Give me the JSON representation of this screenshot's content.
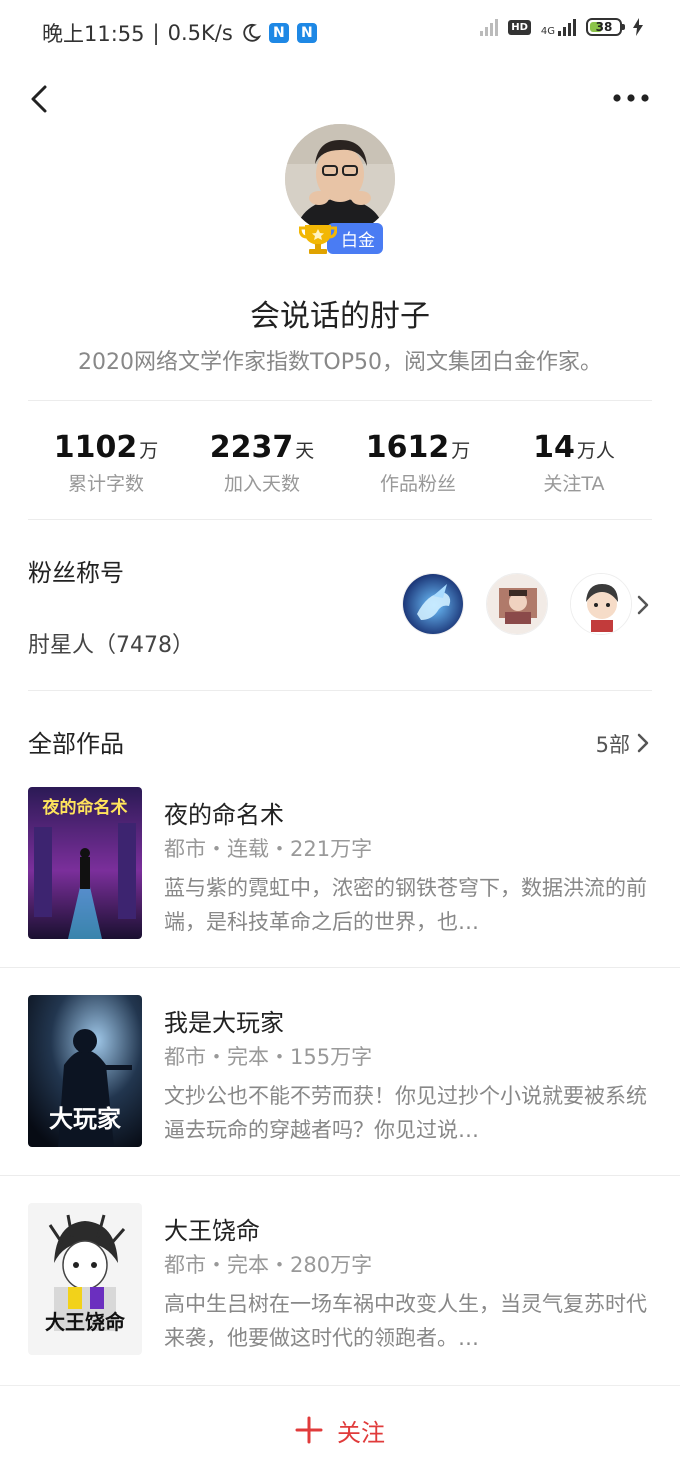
{
  "status_bar": {
    "time": "晚上11:55",
    "separator": "|",
    "speed": "0.5K/s",
    "hd": "HD",
    "network": "4G",
    "battery": "38"
  },
  "header": {
    "back_icon": "chevron-left-icon",
    "more_icon": "more-horizontal-icon"
  },
  "author": {
    "badge": "白金",
    "name": "会说话的肘子",
    "description": "2020网络文学作家指数TOP50，阅文集团白金作家。"
  },
  "stats": [
    {
      "value": "1102",
      "unit": "万",
      "label": "累计字数"
    },
    {
      "value": "2237",
      "unit": "天",
      "label": "加入天数"
    },
    {
      "value": "1612",
      "unit": "万",
      "label": "作品粉丝"
    },
    {
      "value": "14",
      "unit": "万人",
      "label": "关注TA"
    }
  ],
  "fans": {
    "title": "粉丝称号",
    "value": "肘星人（7478）"
  },
  "works": {
    "title": "全部作品",
    "count": "5部",
    "books": [
      {
        "title": "夜的命名术",
        "meta": "都市・连载・221万字",
        "desc": "蓝与紫的霓虹中，浓密的钢铁苍穹下，数据洪流的前端，是科技革命之后的世界，也…",
        "cover_text": "夜的命名术"
      },
      {
        "title": "我是大玩家",
        "meta": "都市・完本・155万字",
        "desc": "文抄公也不能不劳而获！你见过抄个小说就要被系统逼去玩命的穿越者吗？你见过说…",
        "cover_text": "大玩家"
      },
      {
        "title": "大王饶命",
        "meta": "都市・完本・280万字",
        "desc": "高中生吕树在一场车祸中改变人生，当灵气复苏时代来袭，他要做这时代的领跑者。…",
        "cover_text": "大王饶命"
      }
    ]
  },
  "follow": {
    "label": "关注"
  },
  "colors": {
    "accent_red": "#e03b3b",
    "badge_blue": "#4a7cf3"
  }
}
